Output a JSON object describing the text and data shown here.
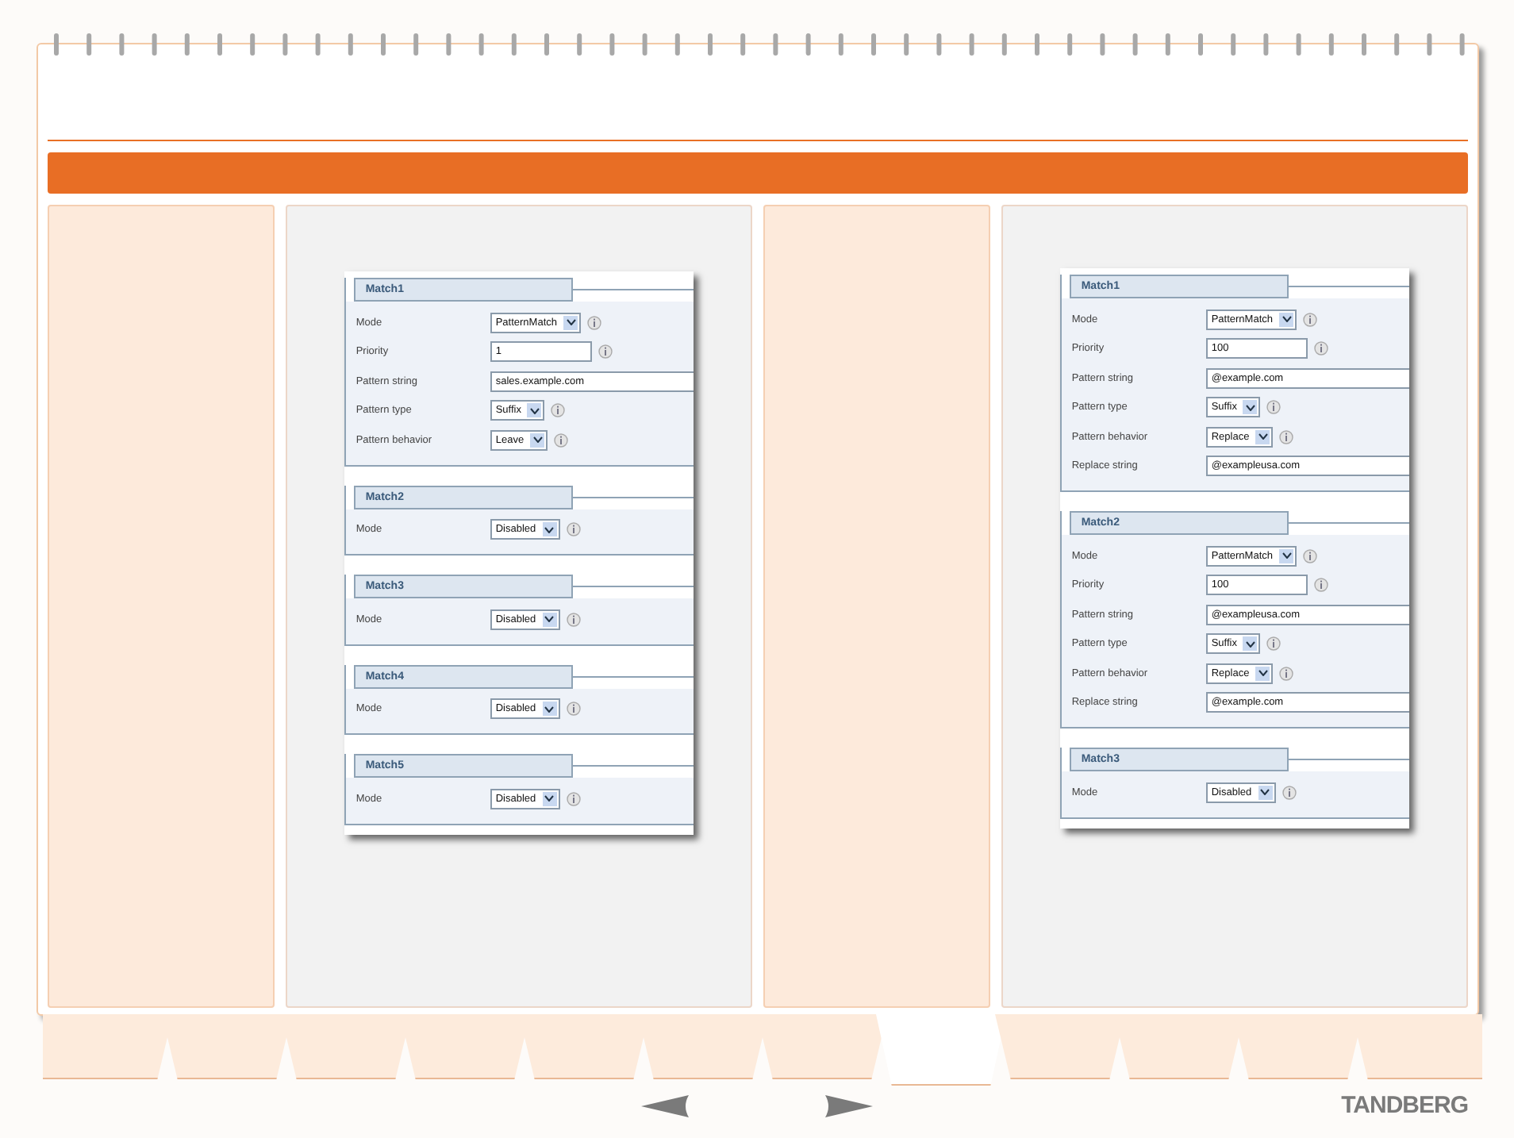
{
  "screenshots": [
    {
      "groups": [
        {
          "title": "Match1",
          "rows": [
            {
              "label": "Mode",
              "kind": "select",
              "value": "PatternMatch"
            },
            {
              "label": "Priority",
              "kind": "text",
              "value": "1"
            },
            {
              "label": "Pattern string",
              "kind": "wide",
              "value": "sales.example.com"
            },
            {
              "label": "Pattern type",
              "kind": "select",
              "value": "Suffix"
            },
            {
              "label": "Pattern behavior",
              "kind": "select",
              "value": "Leave"
            }
          ]
        },
        {
          "title": "Match2",
          "rows": [
            {
              "label": "Mode",
              "kind": "select",
              "value": "Disabled"
            }
          ]
        },
        {
          "title": "Match3",
          "rows": [
            {
              "label": "Mode",
              "kind": "select",
              "value": "Disabled"
            }
          ]
        },
        {
          "title": "Match4",
          "rows": [
            {
              "label": "Mode",
              "kind": "select",
              "value": "Disabled"
            }
          ]
        },
        {
          "title": "Match5",
          "rows": [
            {
              "label": "Mode",
              "kind": "select",
              "value": "Disabled"
            }
          ]
        }
      ]
    },
    {
      "groups": [
        {
          "title": "Match1",
          "rows": [
            {
              "label": "Mode",
              "kind": "select",
              "value": "PatternMatch"
            },
            {
              "label": "Priority",
              "kind": "text",
              "value": "100"
            },
            {
              "label": "Pattern string",
              "kind": "wide",
              "value": "@example.com"
            },
            {
              "label": "Pattern type",
              "kind": "select",
              "value": "Suffix"
            },
            {
              "label": "Pattern behavior",
              "kind": "select",
              "value": "Replace"
            },
            {
              "label": "Replace string",
              "kind": "wide",
              "value": "@exampleusa.com"
            }
          ]
        },
        {
          "title": "Match2",
          "rows": [
            {
              "label": "Mode",
              "kind": "select",
              "value": "PatternMatch"
            },
            {
              "label": "Priority",
              "kind": "text",
              "value": "100"
            },
            {
              "label": "Pattern string",
              "kind": "wide",
              "value": "@exampleusa.com"
            },
            {
              "label": "Pattern type",
              "kind": "select",
              "value": "Suffix"
            },
            {
              "label": "Pattern behavior",
              "kind": "select",
              "value": "Replace"
            },
            {
              "label": "Replace string",
              "kind": "wide",
              "value": "@example.com"
            }
          ]
        },
        {
          "title": "Match3",
          "rows": [
            {
              "label": "Mode",
              "kind": "select",
              "value": "Disabled"
            }
          ]
        }
      ]
    }
  ],
  "tabs": [
    {
      "selected": false
    },
    {
      "selected": false
    },
    {
      "selected": false
    },
    {
      "selected": false
    },
    {
      "selected": false
    },
    {
      "selected": false
    },
    {
      "selected": false
    },
    {
      "selected": true
    },
    {
      "selected": false
    },
    {
      "selected": false
    },
    {
      "selected": false
    },
    {
      "selected": false
    }
  ],
  "logo": "TANDBERG"
}
